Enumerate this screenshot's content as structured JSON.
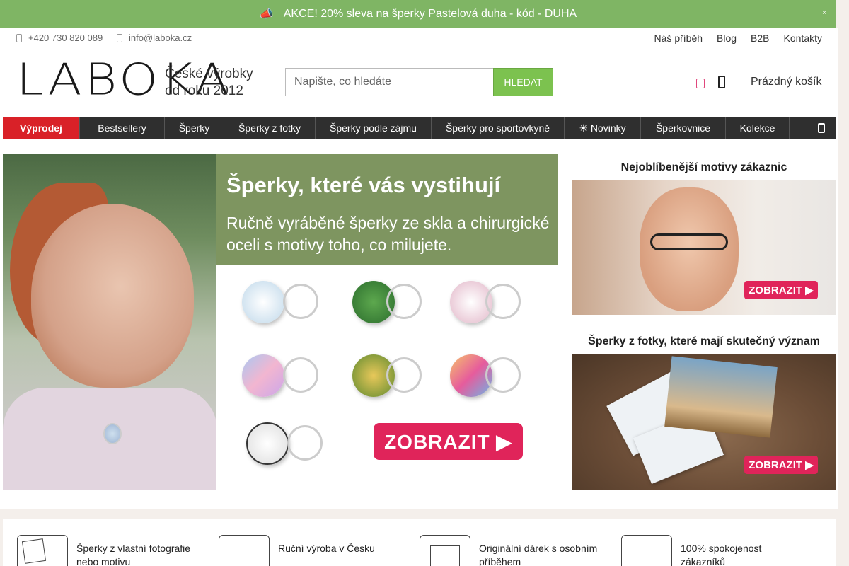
{
  "promo": {
    "text": "AKCE! 20% sleva na šperky Pastelová duha - kód - DUHA",
    "icon": "megaphone-icon",
    "close": "×"
  },
  "topbar": {
    "phone": "+420 730 820 089",
    "email": "info@laboka.cz",
    "links": [
      "Náš příběh",
      "Blog",
      "B2B",
      "Kontakty"
    ]
  },
  "header": {
    "logo": "LABOKA",
    "tagline": "České výrobky od roku 2012",
    "search_placeholder": "Napište, co hledáte",
    "search_button": "HLEDAT",
    "cart_label": "Prázdný košík"
  },
  "nav": {
    "items": [
      "Výprodej",
      "Bestsellery",
      "Šperky",
      "Šperky z fotky",
      "Šperky podle zájmu",
      "Šperky pro sportovkyně",
      "☀ Novinky",
      "Šperkovnice",
      "Kolekce"
    ]
  },
  "hero": {
    "title": "Šperky, které vás vystihují",
    "subtitle": "Ručně vyráběné šperky ze skla a chirurgické oceli s motivy toho, co milujete.",
    "cta": "ZOBRAZIT ▶"
  },
  "side_banners": [
    {
      "title": "Nejoblíbenější motivy zákaznic",
      "cta": "ZOBRAZIT ▶"
    },
    {
      "title": "Šperky z fotky, které mají skutečný význam",
      "cta": "ZOBRAZIT ▶"
    }
  ],
  "usps": [
    {
      "text": "Šperky z vlastní fotografie nebo motivu",
      "icon": "photo-frame-icon"
    },
    {
      "text": "Ruční výroba v Česku",
      "icon": "handmade-icon"
    },
    {
      "text": "Originální dárek s osobním příběhem",
      "icon": "gift-icon"
    },
    {
      "text": "100% spokojenost zákazníků",
      "icon": "thumbs-up-icon"
    }
  ],
  "colors": {
    "promo_bg": "#7fb564",
    "accent_green": "#7cc24f",
    "sale_red": "#d92128",
    "cta_pink": "#e0245a",
    "nav_bg": "#2f2f2f"
  }
}
